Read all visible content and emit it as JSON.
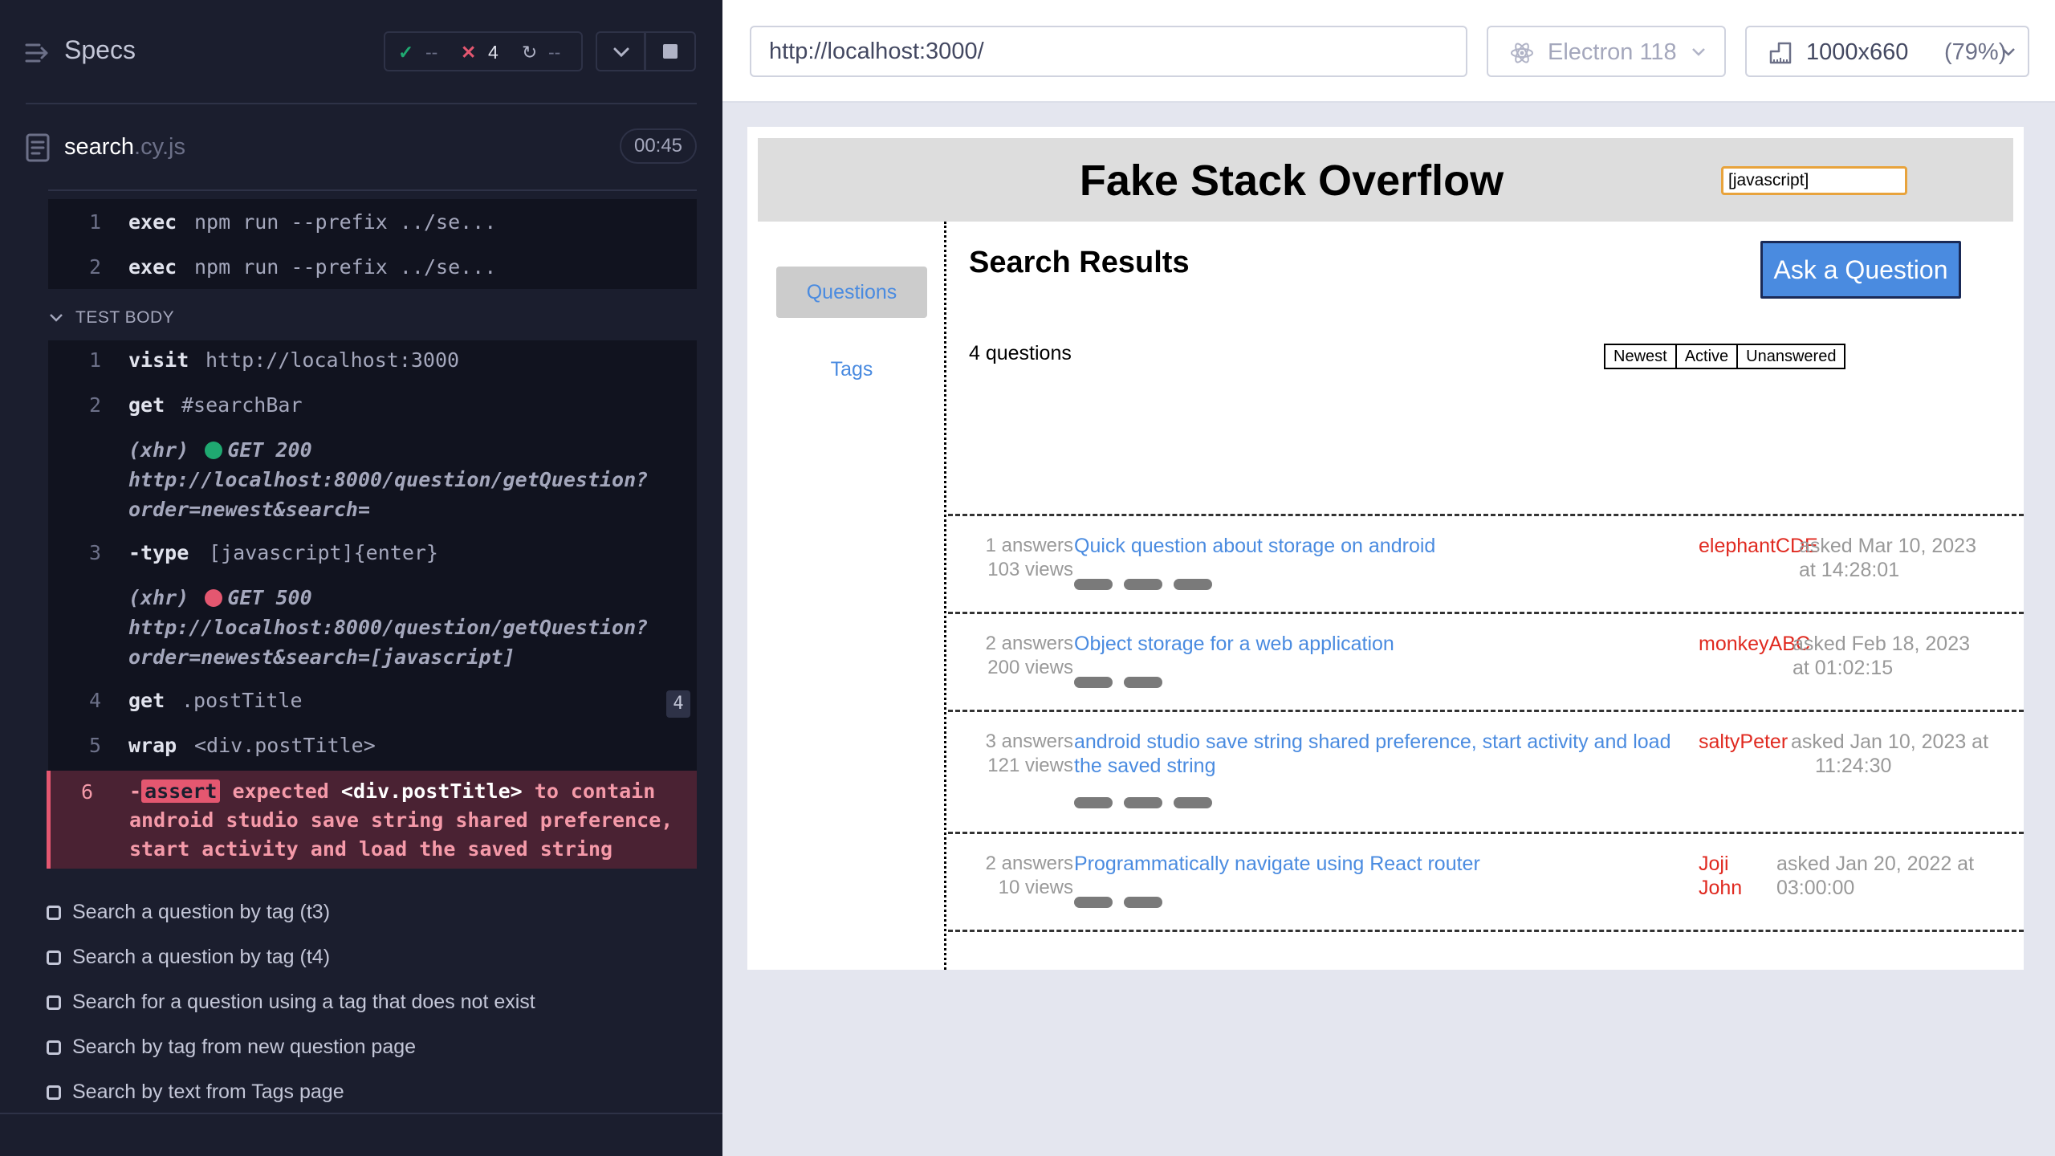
{
  "runner": {
    "specs_label": "Specs",
    "stats": {
      "passed": "--",
      "failed": "4",
      "pending": "--"
    },
    "spec_file": {
      "name": "search",
      "ext": ".cy.js",
      "duration": "00:45"
    },
    "before_commands": [
      {
        "num": "1",
        "name": "exec",
        "message": "npm run --prefix ../se..."
      },
      {
        "num": "2",
        "name": "exec",
        "message": "npm run --prefix ../se..."
      }
    ],
    "test_body_label": "TEST BODY",
    "commands": [
      {
        "num": "1",
        "name": "visit",
        "message": "http://localhost:3000"
      },
      {
        "num": "2",
        "name": "get",
        "message": "#searchBar"
      },
      {
        "num": "3",
        "name": "-type",
        "message": "[javascript]{enter}"
      },
      {
        "num": "4",
        "name": "get",
        "message": ".postTitle",
        "count": "4"
      },
      {
        "num": "5",
        "name": "wrap",
        "message": "<div.postTitle>"
      }
    ],
    "xhr": [
      {
        "tag": "(xhr)",
        "status": "GET 200",
        "url1": "http://localhost:8000/question/getQuestion?",
        "url2": "order=newest&search="
      },
      {
        "tag": "(xhr)",
        "status": "GET 500",
        "url1": "http://localhost:8000/question/getQuestion?",
        "url2": "order=newest&search=[javascript]"
      }
    ],
    "failed_command": {
      "num": "6",
      "prefix": "-",
      "name": "assert",
      "word1": "expected",
      "selector": "<div.postTitle>",
      "word2": "to contain",
      "text": "android studio save string shared preference, start activity and load the saved string"
    },
    "tests": [
      "Search a question by tag (t3)",
      "Search a question by tag (t4)",
      "Search for a question using a tag that does not exist",
      "Search by tag from new question page",
      "Search by text from Tags page"
    ]
  },
  "browser": {
    "url": "http://localhost:3000/",
    "browser_name": "Electron 118",
    "viewport": "1000x660",
    "scale": "(79%)"
  },
  "app": {
    "title": "Fake Stack Overflow",
    "search_value": "[javascript]",
    "nav": {
      "questions": "Questions",
      "tags": "Tags"
    },
    "page_title": "Search Results",
    "ask_button": "Ask a Question",
    "question_count": "4 questions",
    "sort": [
      "Newest",
      "Active",
      "Unanswered"
    ],
    "questions": [
      {
        "answers": "1 answers",
        "views": "103 views",
        "title": "Quick question about storage on android",
        "author": "elephantCDE",
        "asked1": "asked Mar 10, 2023",
        "asked2": "at 14:28:01",
        "tags": 3
      },
      {
        "answers": "2 answers",
        "views": "200 views",
        "title": "Object storage for a web application",
        "author": "monkeyABC",
        "asked1": "asked Feb 18, 2023",
        "asked2": "at 01:02:15",
        "tags": 2
      },
      {
        "answers": "3 answers",
        "views": "121 views",
        "title": "android studio save string shared preference, start activity and load the saved string",
        "author": "saltyPeter",
        "asked1": "asked Jan 10, 2023 at",
        "asked2": "11:24:30",
        "tags": 3
      },
      {
        "answers": "2 answers",
        "views": "10 views",
        "title": "Programmatically navigate using React router",
        "author": "Joji John",
        "asked1": "asked Jan 20, 2022 at",
        "asked2": "03:00:00",
        "tags": 2
      }
    ]
  },
  "colors": {
    "runner_bg": "#1b1e2e",
    "pass": "#1fa971",
    "fail": "#e45770",
    "link_blue": "#4a8be0",
    "author_red": "#e02a20",
    "search_focus": "#e8a33c"
  }
}
